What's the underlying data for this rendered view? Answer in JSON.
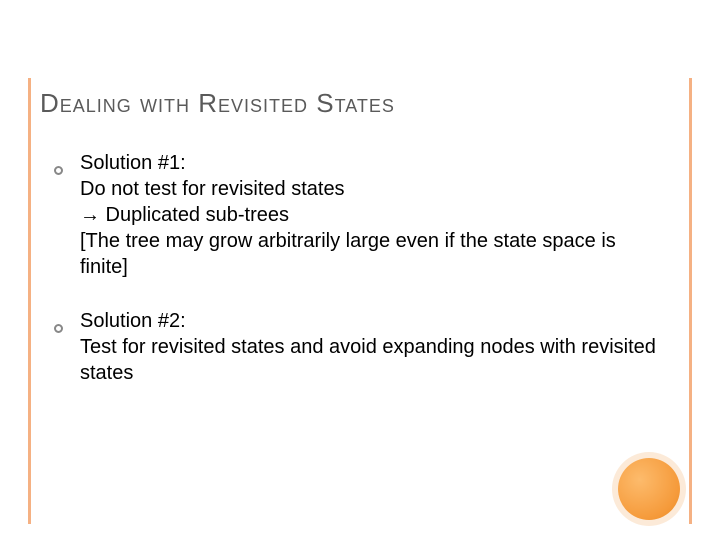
{
  "title": "Dealing with Revisited States",
  "bullets": [
    {
      "heading": "Solution #1:",
      "line1": "Do not test for revisited states",
      "arrow": "→",
      "line2_after_arrow": " Duplicated sub-trees",
      "bracket": "[The tree may grow arbitrarily large even if the state space is finite]"
    },
    {
      "heading": "Solution #2:",
      "line1": "Test for revisited states and avoid expanding nodes with revisited states"
    }
  ]
}
